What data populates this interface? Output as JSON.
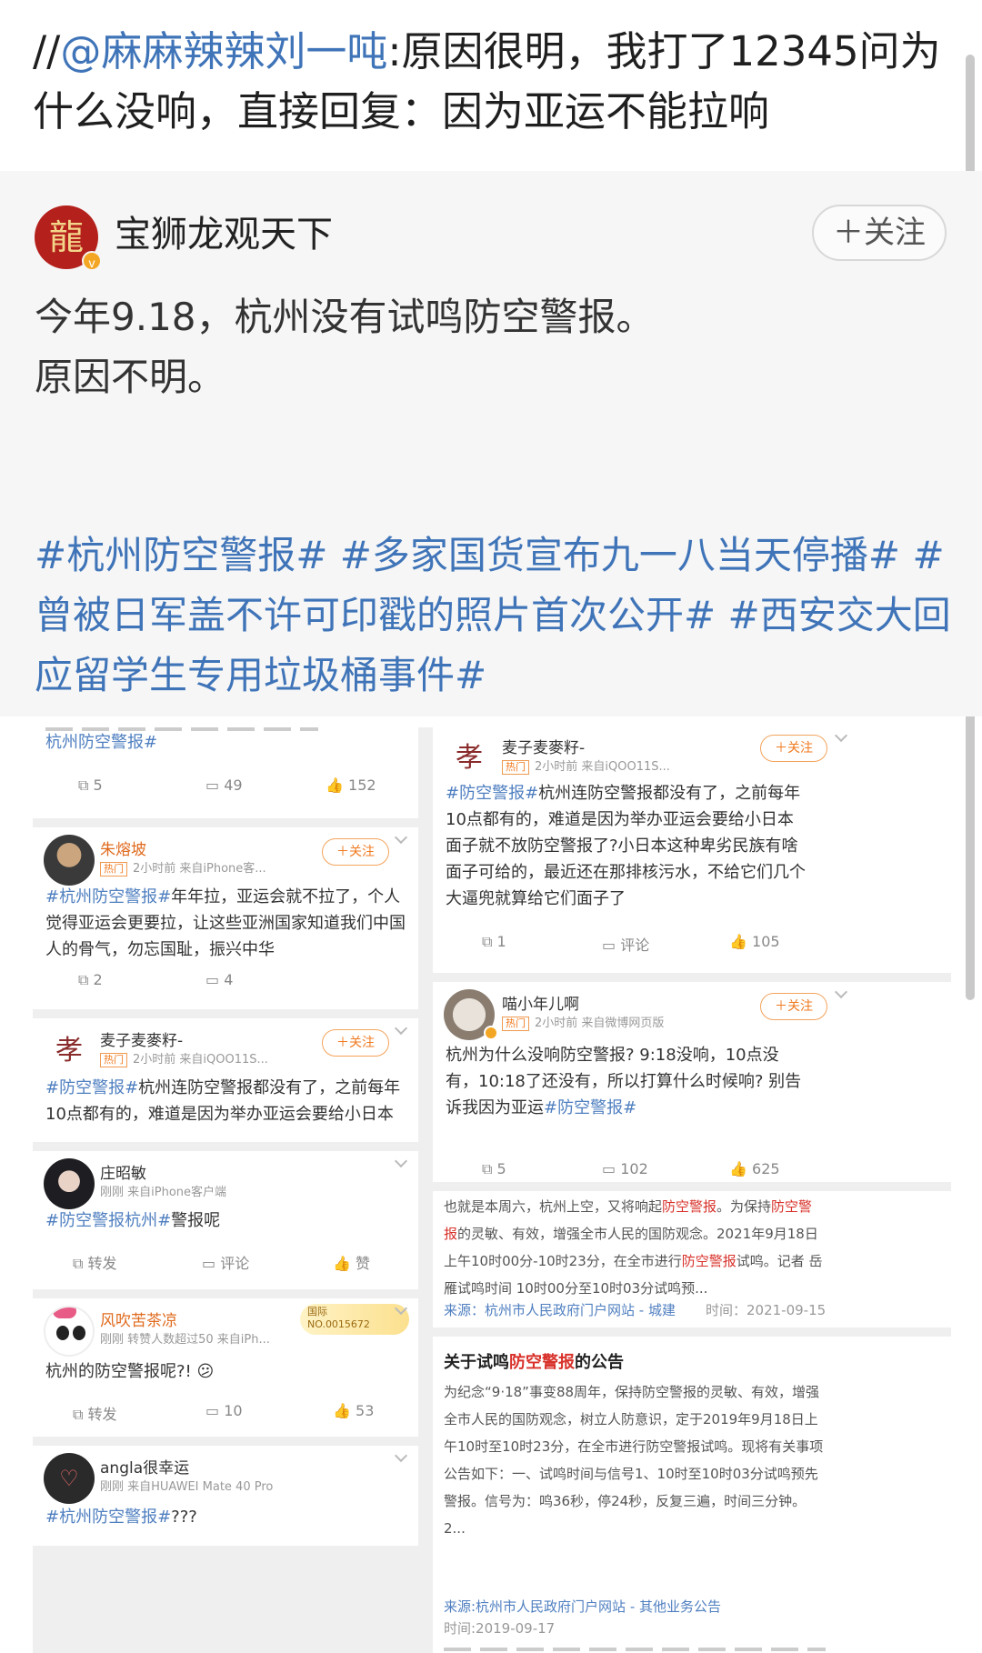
{
  "repost": {
    "prefix": "//",
    "mention": "@麻麻辣辣刘一吨",
    "text": ":原因很明，我打了12345问为什么没响，直接回复：因为亚运不能拉响"
  },
  "original_post": {
    "author": "宝狮龙观天下",
    "avatar_glyph": "龍",
    "follow_label": "＋关注",
    "line1": "今年9.18，杭州没有试鸣防空警报。",
    "line2": "原因不明。",
    "hashtags": "#杭州防空警报# #多家国货宣布九一八当天停播# #曾被日军盖不许可印戳的照片首次公开# #西安交大回应留学生专用垃圾桶事件#"
  },
  "screenshots": {
    "left": [
      {
        "partial_tag": "杭州防空警报#",
        "repost_count": "5",
        "comment_count": "49",
        "like_count": "152"
      },
      {
        "name": "朱熔坡",
        "hot": "热门",
        "meta": "2小时前  来自iPhone客...",
        "follow": "＋关注",
        "tag": "#杭州防空警报#",
        "text": "年年拉，亚运会就不拉了，个人觉得亚运会更要拉，让这些亚洲国家知道我们中国人的骨气，勿忘国耻，振兴中华",
        "repost_count": "2",
        "comment_count": "4"
      },
      {
        "name": "麦子麦麥籽-",
        "hot": "热门",
        "meta": "2小时前  来自iQOO11S...",
        "follow": "＋关注",
        "tag": "#防空警报#",
        "text": "杭州连防空警报都没有了，之前每年10点都有的，难道是因为举办亚运会要给小日本"
      },
      {
        "name": "庄昭敏",
        "meta": "刚刚  来自iPhone客户端",
        "tag": "#防空警报杭州#",
        "text": "警报呢",
        "repost_label": "转发",
        "comment_label": "评论",
        "like_label": "赞"
      },
      {
        "name": "风吹苦茶凉",
        "meta": "刚刚  转赞人数超过50  来自iPh...",
        "badge_line1": "国际",
        "badge_line2": "NO.0015672",
        "text": "杭州的防空警报呢?!",
        "repost_label": "转发",
        "comment_count": "10",
        "like_count": "53"
      },
      {
        "name": "angla很幸运",
        "meta": "刚刚  来自HUAWEI Mate 40 Pro",
        "tag": "#杭州防空警报#",
        "text": "???"
      }
    ],
    "right": [
      {
        "name": "麦子麦麥籽-",
        "hot": "热门",
        "meta": "2小时前  来自iQOO11S...",
        "follow": "＋关注",
        "tag": "#防空警报#",
        "text": "杭州连防空警报都没有了，之前每年10点都有的，难道是因为举办亚运会要给小日本面子就不放防空警报了?小日本这种卑劣民族有啥面子可给的，最近还在那排核污水，不给它们几个大逼兜就算给它们面子了",
        "repost_count": "1",
        "comment_label": "评论",
        "like_count": "105"
      },
      {
        "name": "喵小年儿啊",
        "hot": "热门",
        "meta": "2小时前  来自微博网页版",
        "follow": "＋关注",
        "text": "杭州为什么没响防空警报? 9:18没响，10点没有，10:18了还没有，所以打算什么时候响? 别告诉我因为亚运",
        "tag": "#防空警报#",
        "repost_count": "5",
        "comment_count": "102",
        "like_count": "625"
      },
      {
        "news_pre": "也就是本周六，杭州上空，又将响起",
        "news_hl1": "防空警报",
        "news_mid1": "。为保持",
        "news_hl2": "防空警报",
        "news_mid2": "的灵敏、有效，增强全市人民的国防观念。2021年9月18日上午10时00分-10时23分，在全市进行",
        "news_hl3": "防空警报",
        "news_post": "试鸣。记者 岳雁试鸣时间 10时00分至10时03分试鸣预...",
        "source": "来源：杭州市人民政府门户网站 - 城建",
        "date": "时间：2021-09-15"
      },
      {
        "title_pre": "关于试鸣",
        "title_hl": "防空警报",
        "title_post": "的公告",
        "body": "为纪念“9·18”事变88周年，保持防空警报的灵敏、有效，增强全市人民的国防观念，树立人防意识，定于2019年9月18日上午10时至10时23分，在全市进行防空警报试鸣。现将有关事项公告如下：一、试鸣时间与信号1、10时至10时03分试鸣预先警报。信号为：鸣36秒，停24秒，反复三遍，时间三分钟。2...",
        "source": "来源:杭州市人民政府门户网站  - 其他业务公告",
        "date": "时间:2019-09-17"
      }
    ]
  },
  "colors": {
    "link_blue": "#3f74b8",
    "follow_orange": "#f07a20",
    "highlight_red": "#d8322b",
    "collage_bg": "#efefef"
  },
  "icons": [
    "repost-icon",
    "comment-icon",
    "like-icon",
    "chevron-down-icon",
    "verified-icon"
  ]
}
